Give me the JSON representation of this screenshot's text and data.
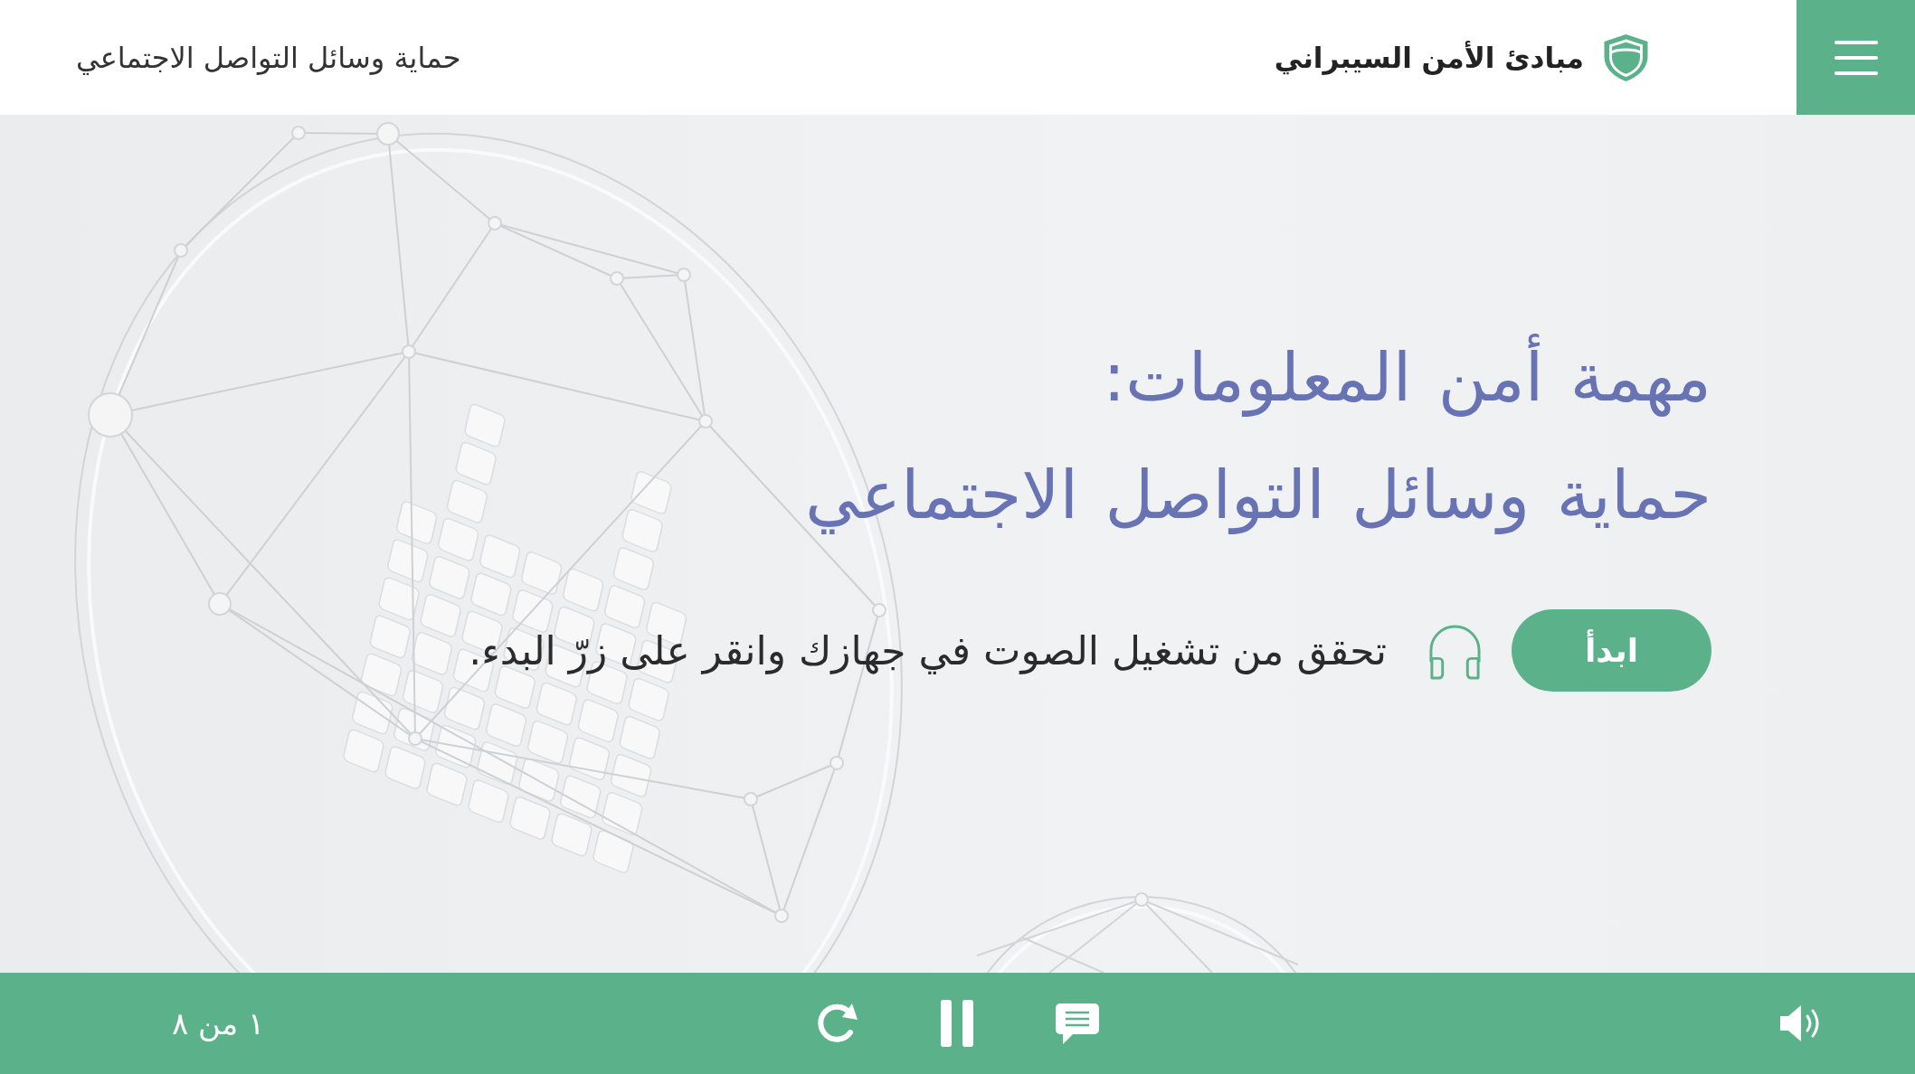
{
  "header": {
    "course_title": "مبادئ الأمن السيبراني",
    "lesson_title": "حماية وسائل التواصل الاجتماعي"
  },
  "intro": {
    "heading_lines": [
      "مهمة أمن المعلومات:",
      "حماية وسائل التواصل الاجتماعي"
    ],
    "start_button": "ابدأ",
    "audio_hint": "تحقق من تشغيل الصوت في جهازك وانقر على زرّ البدء."
  },
  "footer": {
    "page_counter": "١ من ٨"
  }
}
